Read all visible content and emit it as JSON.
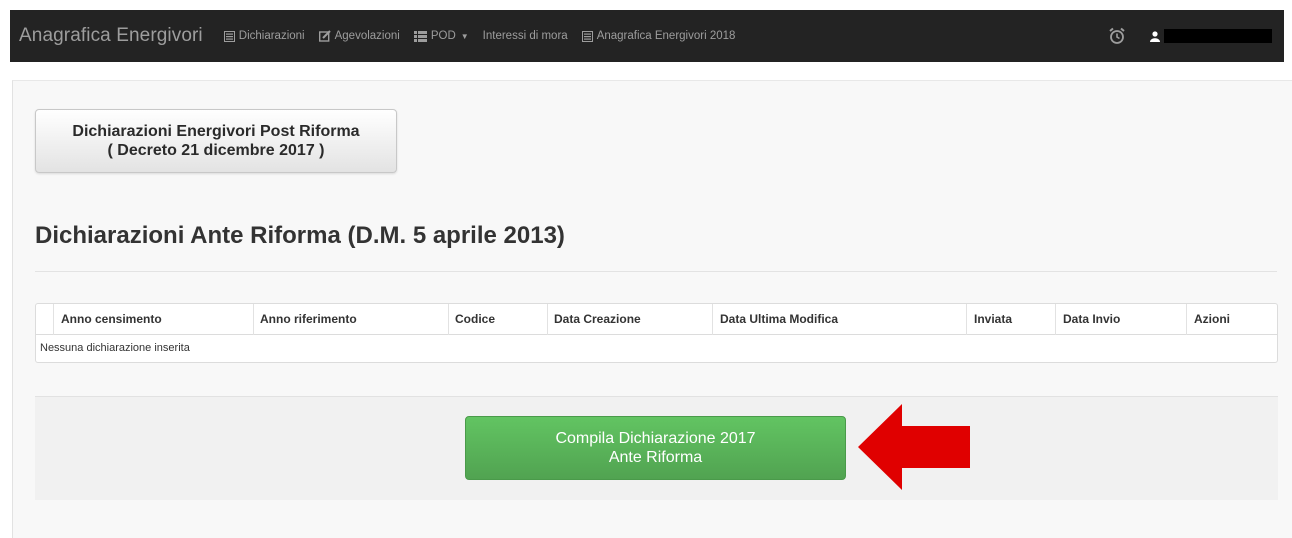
{
  "navbar": {
    "brand": "Anagrafica Energivori",
    "items": [
      {
        "label": "Dichiarazioni",
        "icon": "list-icon"
      },
      {
        "label": "Agevolazioni",
        "icon": "edit-icon"
      },
      {
        "label": "POD",
        "icon": "th-list-icon",
        "dropdown": true
      },
      {
        "label": "Interessi di mora",
        "icon": ""
      },
      {
        "label": "Anagrafica Energivori 2018",
        "icon": "list-icon"
      }
    ],
    "alarm_icon": "alarm-clock-icon",
    "user_icon": "user-icon"
  },
  "post_reform": {
    "line1": "Dichiarazioni Energivori Post Riforma",
    "line2": "( Decreto 21 dicembre 2017 )"
  },
  "section_title": "Dichiarazioni Ante Riforma (D.M. 5 aprile 2013)",
  "table": {
    "columns": [
      "Anno censimento",
      "Anno riferimento",
      "Codice",
      "Data Creazione",
      "Data Ultima Modifica",
      "Inviata",
      "Data Invio",
      "Azioni"
    ],
    "empty_message": "Nessuna dichiarazione inserita"
  },
  "compila": {
    "line1": "Compila Dichiarazione 2017",
    "line2": "Ante Riforma"
  },
  "colors": {
    "navbar_bg": "#232323",
    "green": "#5cb85c",
    "arrow": "#e00000"
  }
}
